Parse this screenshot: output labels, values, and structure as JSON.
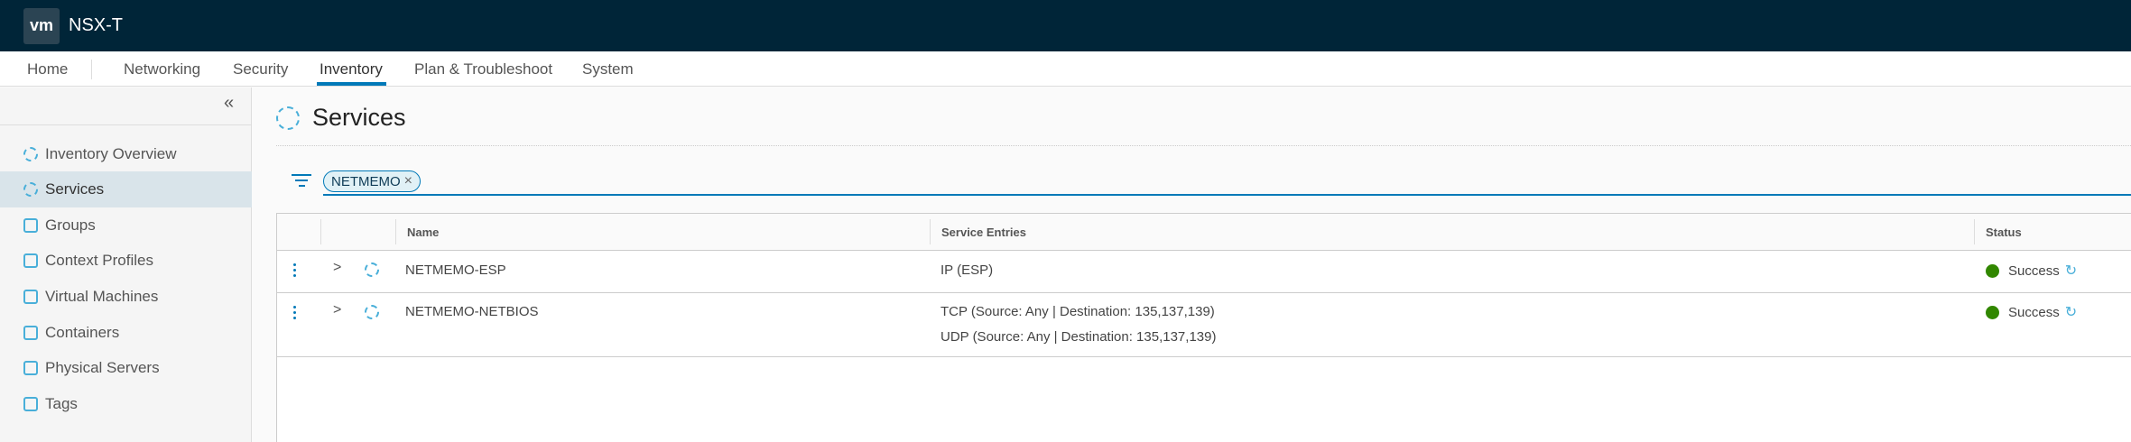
{
  "header": {
    "logo": "vm",
    "app_name": "NSX-T"
  },
  "nav": {
    "items": [
      "Home",
      "Networking",
      "Security",
      "Inventory",
      "Plan & Troubleshoot",
      "System"
    ],
    "active": "Inventory"
  },
  "sidebar": {
    "collapse_icon": "«",
    "items": [
      {
        "label": "Inventory Overview",
        "icon": "dashboard-icon"
      },
      {
        "label": "Services",
        "icon": "gear-icon",
        "selected": true
      },
      {
        "label": "Groups",
        "icon": "groups-icon"
      },
      {
        "label": "Context Profiles",
        "icon": "context-profile-icon"
      },
      {
        "label": "Virtual Machines",
        "icon": "vm-icon"
      },
      {
        "label": "Containers",
        "icon": "container-icon"
      },
      {
        "label": "Physical Servers",
        "icon": "server-icon"
      },
      {
        "label": "Tags",
        "icon": "tag-icon"
      }
    ]
  },
  "page": {
    "title": "Services",
    "filter_chip": "NETMEMO",
    "chip_close": "×"
  },
  "table": {
    "columns": [
      "Name",
      "Service Entries",
      "Status"
    ],
    "rows": [
      {
        "name": "NETMEMO-ESP",
        "entries": [
          "IP (ESP)"
        ],
        "status": "Success"
      },
      {
        "name": "NETMEMO-NETBIOS",
        "entries": [
          "TCP (Source: Any | Destination: 135,137,139)",
          "UDP (Source: Any | Destination: 135,137,139)"
        ],
        "status": "Success"
      }
    ]
  },
  "colors": {
    "header_bg": "#002538",
    "accent": "#0079b8",
    "success": "#318700"
  }
}
